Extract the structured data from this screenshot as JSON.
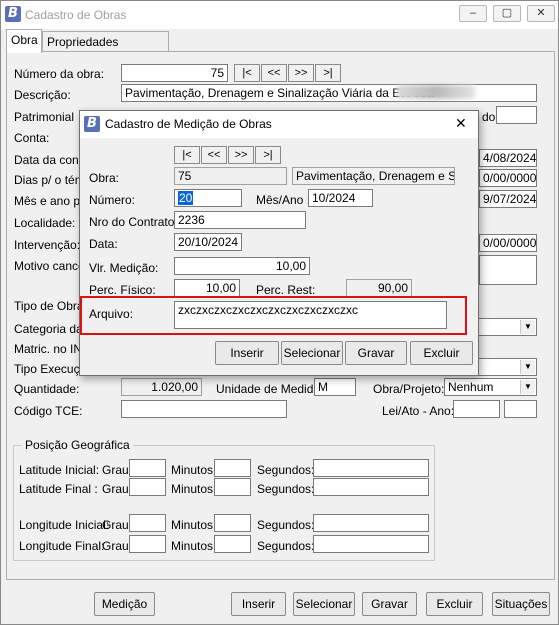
{
  "main_window": {
    "title": "Cadastro de Obras",
    "icon_letter": "B",
    "tabs": [
      "Obra",
      "Propriedades Adicionais"
    ],
    "labels": {
      "numero_obra": "Número da obra:",
      "descricao": "Descrição:",
      "patrimonial": "Patrimonial",
      "conta": "Conta:",
      "data_conc": "Data da conc",
      "dias": "Dias p/ o tém",
      "mes_ano": "Mês e ano p/",
      "localidade": "Localidade:",
      "intervencao": "Intervenção:",
      "motivo": "Motivo cance",
      "tipo_obra": "Tipo de Obra:",
      "categoria": "Categoria da O",
      "matric": "Matric. no INS",
      "tipo_exec": "Tipo Execuçã",
      "quantidade": "Quantidade:",
      "unidade": "Unidade de Medida:",
      "obra_projeto": "Obra/Projeto:",
      "codigo_tce": "Código TCE:",
      "lei_ato": "Lei/Ato - Ano:",
      "bairro_partial": "do:"
    },
    "values": {
      "numero_obra": "75",
      "descricao": "Pavimentação, Drenagem e Sinalização Viária da Estrada",
      "date1": "4/08/2024",
      "zero1": "0/00/0000",
      "date2": "9/07/2024",
      "zero2": "0/00/0000",
      "exec_partial": "l",
      "quantidade": "1.020,00",
      "unidade": "M",
      "obra_projeto": "Nenhum"
    },
    "geo": {
      "title": "Posição Geográfica",
      "rows": [
        {
          "label": "Latitude Inicial:"
        },
        {
          "label": "Latitude Final :"
        },
        {
          "label": "Longitude Inicial:"
        },
        {
          "label": "Longitude Final:"
        }
      ],
      "grau": "Grau:",
      "minutos": "Minutos:",
      "segundos": "Segundos:"
    },
    "nav": [
      "|<",
      "<<",
      ">>",
      ">|"
    ],
    "bottom_buttons": {
      "medicao": "Medição",
      "inserir": "Inserir",
      "selecionar": "Selecionar",
      "gravar": "Gravar",
      "excluir": "Excluir",
      "situacoes": "Situações"
    },
    "window_buttons": [
      "–",
      "▢",
      "✕"
    ]
  },
  "dialog": {
    "title": "Cadastro de Medição de Obras",
    "nav": [
      "|<",
      "<<",
      ">>",
      ">|"
    ],
    "labels": {
      "obra": "Obra:",
      "numero": "Número:",
      "mes_ano": "Mês/Ano :",
      "contrato": "Nro do Contrato:",
      "data": "Data:",
      "vlr": "Vlr. Medição:",
      "perc_fisico": "Perc. Físico:",
      "perc_rest": "Perc. Rest:",
      "arquivo": "Arquivo:"
    },
    "values": {
      "obra_id": "75",
      "obra_desc": "Pavimentação, Drenagem e Sinalização",
      "numero": "20",
      "mes_ano": "10/2024",
      "contrato": "2236",
      "data": "20/10/2024",
      "vlr": "10,00",
      "perc_fisico": "10,00",
      "perc_rest": "90,00",
      "arquivo": "zxczxczxczxczxczxczxczxczxczxc"
    },
    "buttons": {
      "inserir": "Inserir",
      "selecionar": "Selecionar",
      "gravar": "Gravar",
      "excluir": "Excluir"
    },
    "close": "✕"
  }
}
